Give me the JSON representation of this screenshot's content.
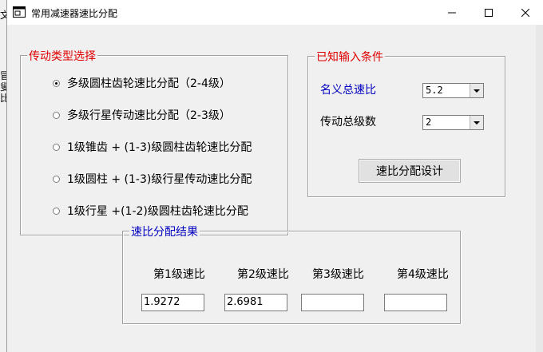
{
  "desktop_chars": [
    "文",
    "冒",
    "叟",
    "比"
  ],
  "window": {
    "title": "常用减速器速比分配",
    "controls": {
      "minimize": "—",
      "maximize": "☐",
      "close": "✕"
    }
  },
  "transmission_group": {
    "label": "传动类型选择",
    "options": [
      {
        "label": "多级圆柱齿轮速比分配（2-4级）",
        "checked": true
      },
      {
        "label": "多级行星传动速比分配（2-3级）",
        "checked": false
      },
      {
        "label": "1级锥齿 + (1-3)级圆柱齿轮速比分配",
        "checked": false
      },
      {
        "label": "1级圆柱 + (1-3)级行星传动速比分配",
        "checked": false
      },
      {
        "label": "1级行星 +(1-2)级圆柱齿轮速比分配",
        "checked": false
      }
    ]
  },
  "input_group": {
    "label": "已知输入条件",
    "ratio_label": "名义总速比",
    "ratio_value": "5.2",
    "stages_label": "传动总级数",
    "stages_value": "2",
    "design_button": "速比分配设计"
  },
  "result_group": {
    "label": "速比分配结果",
    "headers": [
      "第1级速比",
      "第2级速比",
      "第3级速比",
      "第4级速比"
    ],
    "values": [
      "1.9272",
      "2.6981",
      "",
      ""
    ]
  },
  "colors": {
    "red_label": "#e00000",
    "blue_label": "#0000c0"
  }
}
